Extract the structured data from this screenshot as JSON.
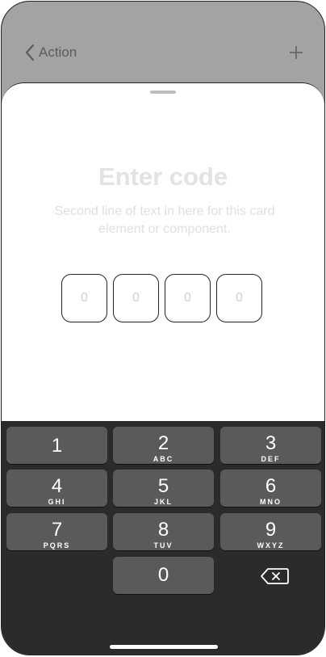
{
  "nav": {
    "back_label": "Action"
  },
  "sheet": {
    "title": "Enter code",
    "subtitle": "Second line of text in here for this card element or component.",
    "code_placeholders": [
      "0",
      "0",
      "0",
      "0"
    ]
  },
  "keypad": {
    "keys": [
      {
        "num": "1",
        "letters": ""
      },
      {
        "num": "2",
        "letters": "ABC"
      },
      {
        "num": "3",
        "letters": "DEF"
      },
      {
        "num": "4",
        "letters": "GHI"
      },
      {
        "num": "5",
        "letters": "JKL"
      },
      {
        "num": "6",
        "letters": "MNO"
      },
      {
        "num": "7",
        "letters": "PQRS"
      },
      {
        "num": "8",
        "letters": "TUV"
      },
      {
        "num": "9",
        "letters": "WXYZ"
      },
      {
        "num": "0",
        "letters": ""
      }
    ]
  },
  "colors": {
    "backdrop": "#a3a3a3",
    "keyboard": "#2b2b2b",
    "key": "#5a5a5a"
  }
}
